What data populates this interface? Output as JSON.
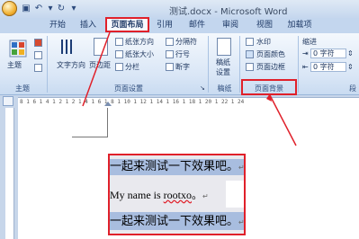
{
  "window": {
    "title": "测试.docx - Microsoft Word"
  },
  "tabs": [
    "开始",
    "插入",
    "页面布局",
    "引用",
    "邮件",
    "审阅",
    "视图",
    "加载项"
  ],
  "ribbon": {
    "themes": {
      "button": "主题",
      "group": "主题"
    },
    "page_setup": {
      "text_direction": "文字方向",
      "margins": "页边距",
      "orientation": "纸张方向",
      "size": "纸张大小",
      "columns": "分栏",
      "breaks": "分隔符",
      "line_numbers": "行号",
      "hyphenation": "断字",
      "group": "页面设置"
    },
    "manuscript": {
      "button_line1": "稿纸",
      "button_line2": "设置",
      "group": "稿纸"
    },
    "page_background": {
      "watermark": "水印",
      "page_color": "页面颜色",
      "page_borders": "页面边框",
      "group": "页面背景"
    },
    "paragraph": {
      "indent": "缩进",
      "left_value": "0 字符",
      "right_value": "0 字符",
      "group": "段"
    }
  },
  "ruler": {
    "marks": "8 1 6 1 4 1 2 1   2 1 4 1 6 1 8 1 10 1 12 1 14 1 16 1 18 1 20 1 22 1 24"
  },
  "document": {
    "line1": "一起来测试一下效果吧。",
    "line2_pre": "My name is ",
    "line2_word": "rootxo",
    "line2_post": "。",
    "line3": "一起来测试一下效果吧。",
    "para_mark": "↵"
  },
  "colors": {
    "annotation_red": "#e0202a",
    "selection": "#a8bddf"
  }
}
